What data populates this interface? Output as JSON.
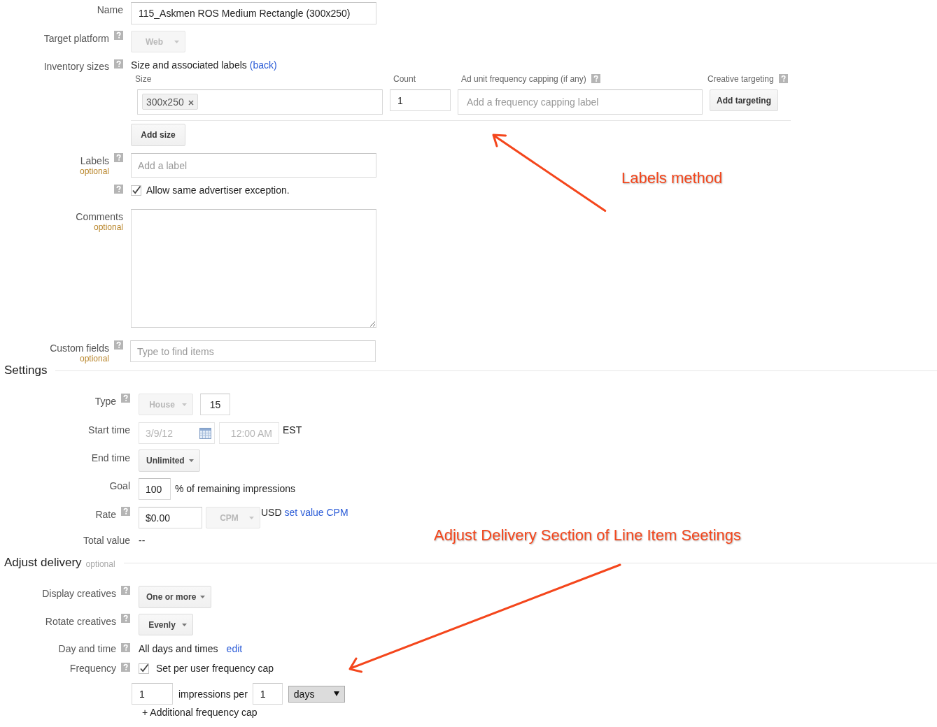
{
  "details": {
    "name": {
      "label": "Name",
      "value": "115_Askmen ROS Medium Rectangle (300x250)"
    },
    "target_platform": {
      "label": "Target platform",
      "help": true,
      "value": "Web",
      "disabled": true
    },
    "inventory_sizes": {
      "label": "Inventory sizes",
      "help": true,
      "heading": "Size and associated labels",
      "back_link": "(back)",
      "columns": [
        {
          "label": "Size",
          "help": false
        },
        {
          "label": "Count",
          "help": false
        },
        {
          "label": "Ad unit frequency capping (if any)",
          "help": true
        },
        {
          "label": "Creative targeting",
          "help": true
        }
      ],
      "rows": [
        {
          "sizes": [
            "300x250"
          ],
          "count": "1",
          "capping_placeholder": "Add a frequency capping label",
          "targeting_button": "Add targeting"
        }
      ],
      "add_button": "Add size"
    },
    "labels": {
      "label": "Labels",
      "note": "optional",
      "help": true,
      "placeholder": "Add a label"
    },
    "exception": {
      "help": true,
      "label": "Allow same advertiser exception.",
      "checked": true
    },
    "comments": {
      "label": "Comments",
      "note": "optional"
    },
    "custom_fields": {
      "label": "Custom fields",
      "note": "optional",
      "help": true,
      "placeholder": "Type to find items"
    }
  },
  "settings": {
    "title": "Settings",
    "type": {
      "label": "Type",
      "help": true,
      "value": "House",
      "disabled": true,
      "priority": "15"
    },
    "start_time": {
      "label": "Start time",
      "date": "3/9/12",
      "time": "12:00 AM",
      "timezone": "EST",
      "disabled": true
    },
    "end_time": {
      "label": "End time",
      "value": "Unlimited"
    },
    "goal": {
      "label": "Goal",
      "value": "100",
      "suffix": "% of remaining impressions"
    },
    "rate": {
      "label": "Rate",
      "help": true,
      "value": "$0.00",
      "unit": "CPM",
      "unit_disabled": true,
      "currency": "USD",
      "link": "set value CPM"
    },
    "total_value": {
      "label": "Total value",
      "value": "--"
    }
  },
  "adjust_delivery": {
    "title": "Adjust delivery",
    "note": "optional",
    "display_creatives": {
      "label": "Display creatives",
      "help": true,
      "value": "One or more"
    },
    "rotate_creatives": {
      "label": "Rotate creatives",
      "help": true,
      "value": "Evenly"
    },
    "day_and_time": {
      "label": "Day and time",
      "help": true,
      "value": "All days and times",
      "link": "edit"
    },
    "frequency": {
      "label": "Frequency",
      "help": true,
      "checkbox_label": "Set per user frequency cap",
      "checked": true,
      "impressions": "1",
      "per_label": "impressions per",
      "period": "1",
      "unit": "days",
      "add_link": "+ Additional frequency cap"
    }
  },
  "annotations": [
    {
      "text": "Labels method"
    },
    {
      "text": "Adjust Delivery Section of Line Item Seetings"
    }
  ]
}
